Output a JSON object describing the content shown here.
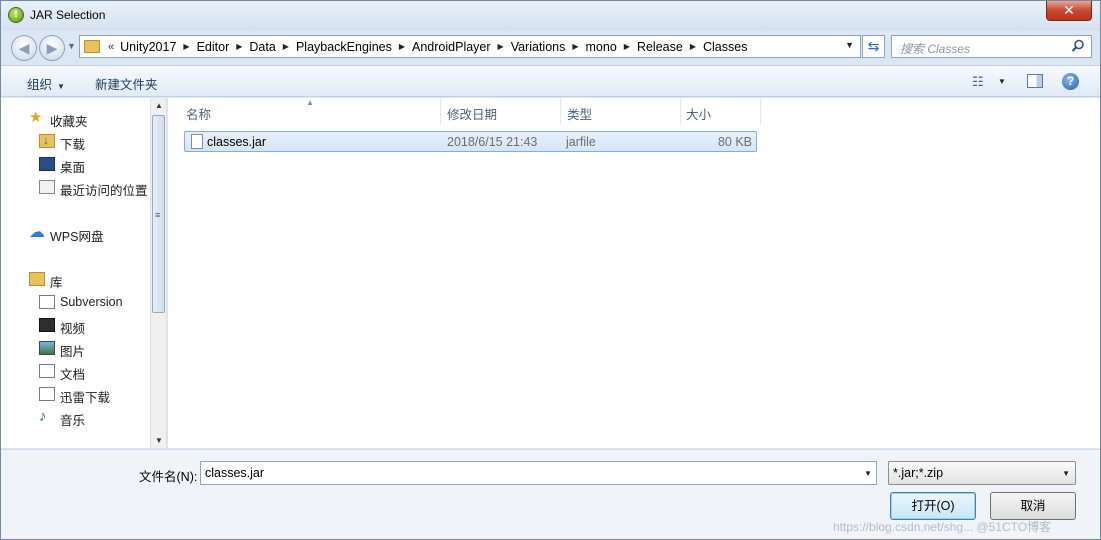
{
  "window": {
    "title": "JAR Selection",
    "close_label": "✕"
  },
  "navigation": {
    "overflow": "«",
    "breadcrumbs": [
      "Unity2017",
      "Editor",
      "Data",
      "PlaybackEngines",
      "AndroidPlayer",
      "Variations",
      "mono",
      "Release",
      "Classes"
    ],
    "search_placeholder": "搜索 Classes"
  },
  "toolbar": {
    "organize_label": "组织",
    "new_folder_label": "新建文件夹"
  },
  "sidebar": {
    "favorites_label": "收藏夹",
    "favorites": [
      "下载",
      "桌面",
      "最近访问的位置"
    ],
    "wps_label": "WPS网盘",
    "libraries_label": "库",
    "libraries": [
      "Subversion",
      "视频",
      "图片",
      "文档",
      "迅雷下载",
      "音乐"
    ]
  },
  "file_list": {
    "columns": [
      "名称",
      "修改日期",
      "类型",
      "大小"
    ],
    "rows": [
      {
        "name": "classes.jar",
        "date": "2018/6/15 21:43",
        "type": "jarfile",
        "size": "80 KB"
      }
    ]
  },
  "bottom": {
    "filename_label": "文件名(N):",
    "filename_value": "classes.jar",
    "filter_value": "*.jar;*.zip",
    "open_label": "打开(O)",
    "cancel_label": "取消"
  },
  "watermark": "https://blog.csdn.net/shg... @51CTO博客"
}
